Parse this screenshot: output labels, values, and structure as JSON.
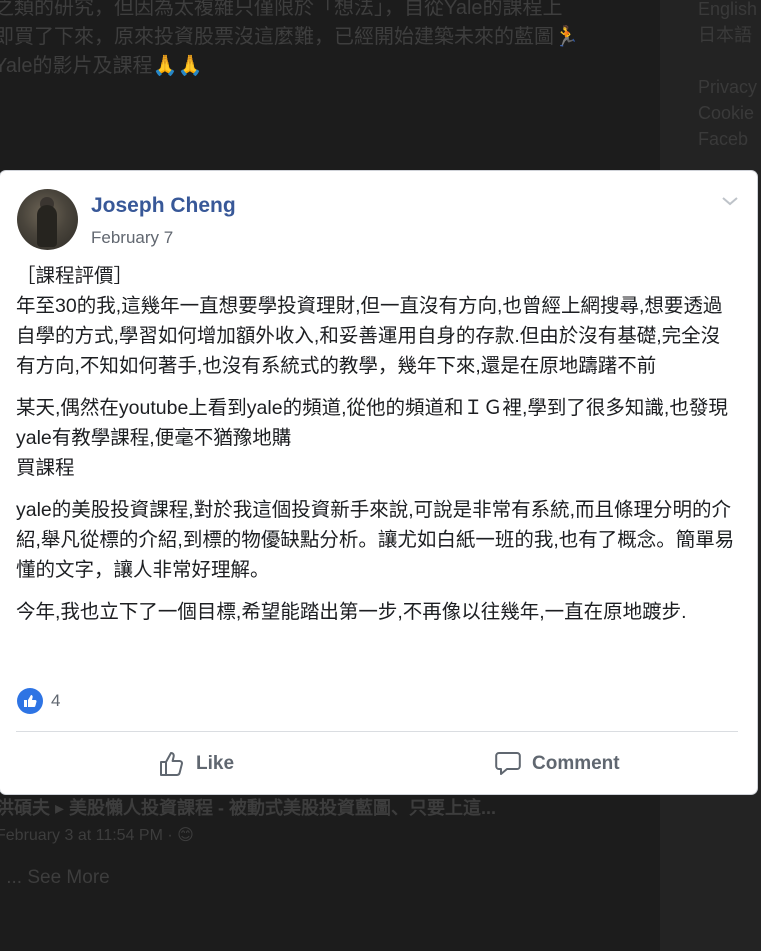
{
  "background": {
    "post_lines": [
      "之類的研究，但因為太複雜只僅限於「想法」，自從Yale的課程上",
      "即買了下來，原來投資股票沒這麼難，已經開始建築未來的藍圖🏃",
      "Yale的影片及課程🙏🙏"
    ],
    "sidebar_links": [
      "English",
      "日本語",
      "Privacy",
      "Cookie",
      "Faceb"
    ],
    "comment_preview": {
      "author_and_title": "洪碩夫 ▸ 美股懶人投資課程 - 被動式美股投資藍圖、只要上這...",
      "timestamp": "February 3 at 11:54 PM · 😊",
      "see_more": "∶ ... See More"
    }
  },
  "post": {
    "author": "Joseph Cheng",
    "date": "February 7",
    "paragraphs": [
      "［課程評價］\n年至30的我,這幾年一直想要學投資理財,但一直沒有方向,也曾經上網搜尋,想要透過自學的方式,學習如何增加額外收入,和妥善運用自身的存款.但由於沒有基礎,完全沒有方向,不知如何著手,也沒有系統式的教學，幾年下來,還是在原地躊躇不前",
      "某天,偶然在youtube上看到yale的頻道,從他的頻道和ＩＧ裡,學到了很多知識,也發現yale有教學課程,便毫不猶豫地購\n買課程",
      "yale的美股投資課程,對於我這個投資新手來說,可說是非常有系統,而且條理分明的介紹,舉凡從標的介紹,到標的物優缺點分析。讓尤如白紙一班的我,也有了概念。簡單易懂的文字，讓人非常好理解。",
      "今年,我也立下了一個目標,希望能踏出第一步,不再像以往幾年,一直在原地踱步."
    ],
    "reaction_count": "4",
    "like_label": "Like",
    "comment_label": "Comment"
  },
  "colors": {
    "author_link": "#385898",
    "like_badge": "#2e74e4",
    "secondary_text": "#606770"
  },
  "icons": [
    "chevron-down-icon",
    "thumbs-up-icon",
    "comment-bubble-icon"
  ]
}
